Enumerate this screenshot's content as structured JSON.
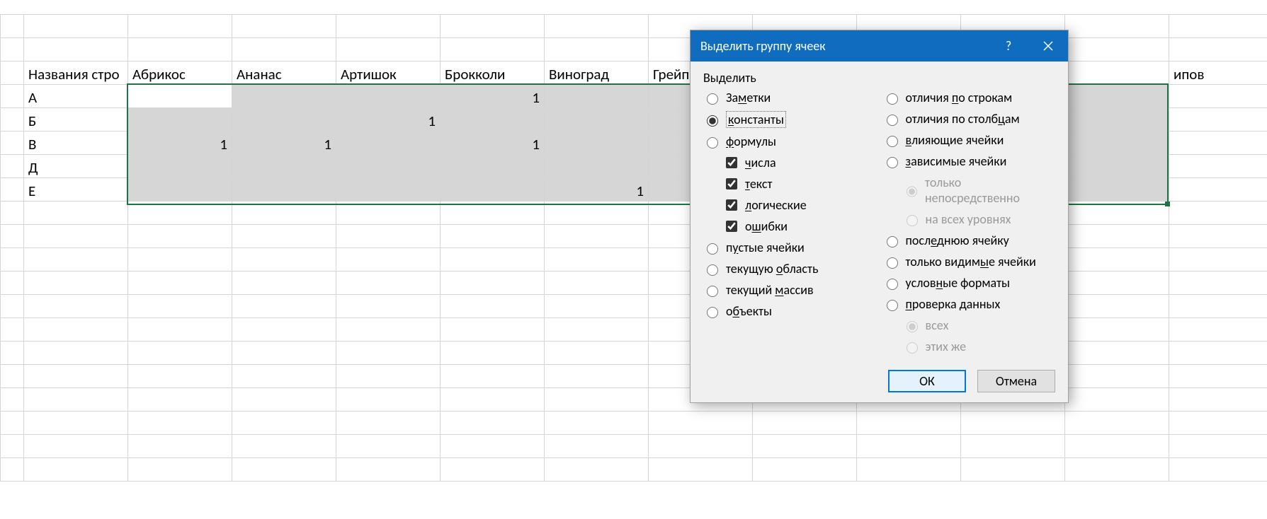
{
  "sheet": {
    "header_row_label": "Названия стро",
    "columns": [
      "Абрикос",
      "Ананас",
      "Артишок",
      "Брокколи",
      "Виноград",
      "Грейп",
      "",
      "",
      "",
      "",
      "ипов"
    ],
    "rows": [
      {
        "label": "А",
        "cells": [
          "",
          "",
          "",
          "1",
          "",
          "",
          "",
          "",
          "",
          "",
          ""
        ]
      },
      {
        "label": "Б",
        "cells": [
          "",
          "",
          "1",
          "",
          "",
          "",
          "",
          "",
          "",
          "",
          ""
        ]
      },
      {
        "label": "В",
        "cells": [
          "1",
          "1",
          "",
          "1",
          "",
          "",
          "",
          "",
          "",
          "",
          ""
        ]
      },
      {
        "label": "Д",
        "cells": [
          "",
          "",
          "",
          "",
          "",
          "",
          "",
          "",
          "",
          "",
          ""
        ]
      },
      {
        "label": "Е",
        "cells": [
          "",
          "",
          "",
          "",
          "1",
          "",
          "",
          "",
          "",
          "",
          ""
        ]
      }
    ]
  },
  "dialog": {
    "title": "Выделить группу ячеек",
    "group_label": "Выделить",
    "left": {
      "notes": "Заметки",
      "constants": "константы",
      "formulas": "формулы",
      "numbers": "числа",
      "text": "текст",
      "logical": "логические",
      "errors": "ошибки",
      "blanks": "пустые ячейки",
      "current_region": "текущую область",
      "current_array": "текущий массив",
      "objects": "объекты"
    },
    "right": {
      "row_diffs": "отличия по строкам",
      "col_diffs": "отличия по столбцам",
      "precedents": "влияющие ячейки",
      "dependents": "зависимые ячейки",
      "direct_only": "только непосредственно",
      "all_levels": "на всех уровнях",
      "last_cell": "последнюю ячейку",
      "visible_only": "только видимые ячейки",
      "cond_formats": "условные форматы",
      "data_validation": "проверка данных",
      "all": "всех",
      "same": "этих же"
    },
    "buttons": {
      "ok": "ОК",
      "cancel": "Отмена"
    }
  }
}
